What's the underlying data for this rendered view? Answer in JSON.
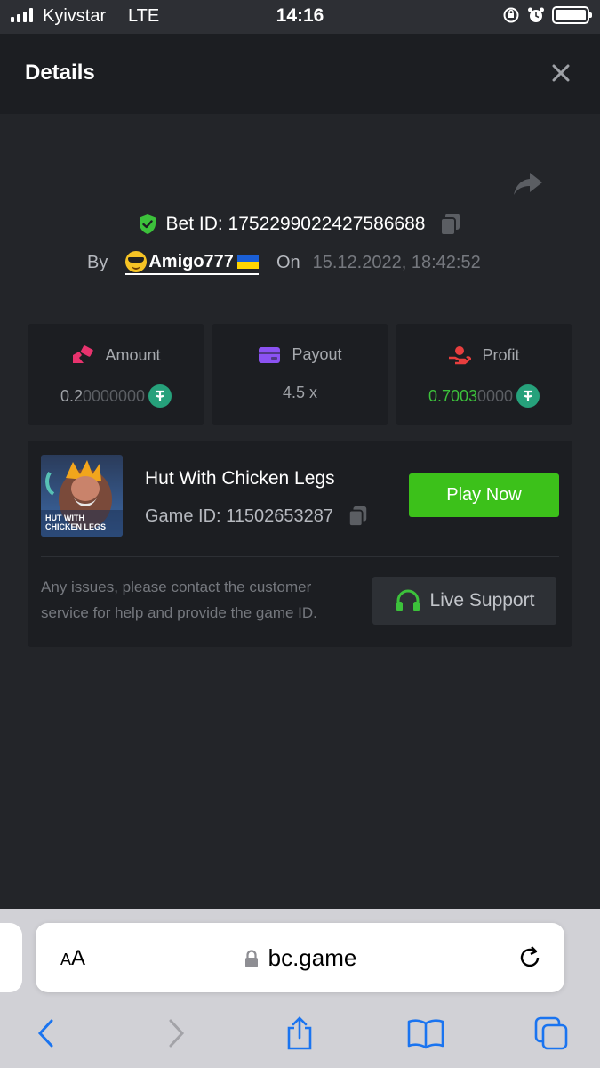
{
  "status_bar": {
    "carrier": "Kyivstar",
    "network": "LTE",
    "time": "14:16"
  },
  "header": {
    "title": "Details"
  },
  "bet": {
    "id_label": "Bet ID: 1752299022427586688",
    "by_label": "By",
    "username": "Amigo777",
    "on_label": "On",
    "date": "15.12.2022, 18:42:52"
  },
  "stats": {
    "amount": {
      "label": "Amount",
      "value_main": "0.2",
      "value_dim": "0000000"
    },
    "payout": {
      "label": "Payout",
      "value": "4.5 x"
    },
    "profit": {
      "label": "Profit",
      "value_main": "0.7003",
      "value_dim": "0000"
    }
  },
  "game": {
    "name": "Hut With Chicken Legs",
    "id_label": "Game ID: 11502653287",
    "thumb_text_line1": "HUT WITH",
    "thumb_text_line2": "CHICKEN LEGS",
    "play_label": "Play Now"
  },
  "support": {
    "text": "Any issues, please contact the customer service for help and provide the game ID.",
    "button_label": "Live Support"
  },
  "browser": {
    "text_size_label_small": "A",
    "text_size_label_large": "A",
    "domain": "bc.game"
  },
  "colors": {
    "accent_green": "#3cc11a",
    "background": "#232529",
    "card": "#1c1e22"
  }
}
